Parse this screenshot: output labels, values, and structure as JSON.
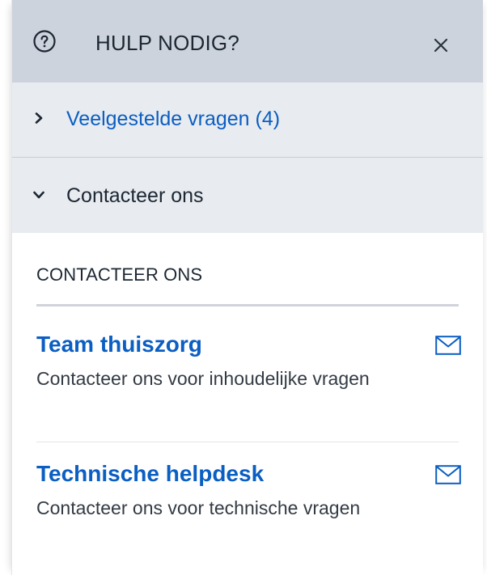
{
  "header": {
    "title": "HULP NODIG?",
    "help_icon": "question-circle-icon",
    "close_icon": "close-icon"
  },
  "accordion": {
    "faq": {
      "label": "Veelgestelde vragen (4)",
      "expanded": false,
      "icon": "chevron-right-icon"
    },
    "contact": {
      "label": "Contacteer ons",
      "expanded": true,
      "icon": "chevron-down-icon"
    }
  },
  "contact_section": {
    "title": "CONTACTEER ONS",
    "items": [
      {
        "title": "Team thuiszorg",
        "description": "Contacteer ons voor inhoudelijke vragen",
        "icon": "mail-icon"
      },
      {
        "title": "Technische helpdesk",
        "description": "Contacteer ons voor technische vragen",
        "icon": "mail-icon"
      }
    ]
  },
  "colors": {
    "header_bg": "#cdd3dc",
    "accordion_bg": "#e8ebef",
    "link_blue": "#0b5ec2",
    "text_dark": "#1c2733"
  }
}
